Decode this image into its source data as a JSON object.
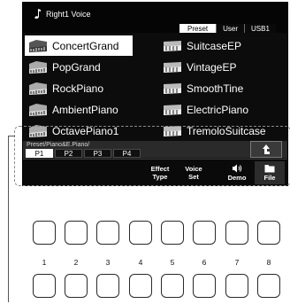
{
  "window": {
    "title": "Right1 Voice",
    "title_icon": "music-note-icon"
  },
  "tabs": [
    {
      "label": "Preset",
      "active": true
    },
    {
      "label": "User",
      "active": false
    },
    {
      "label": "USB1",
      "active": false
    }
  ],
  "voices": [
    {
      "name": "ConcertGrand",
      "icon": "grand-piano-icon",
      "selected": true
    },
    {
      "name": "PopGrand",
      "icon": "grand-piano-icon",
      "selected": false
    },
    {
      "name": "RockPiano",
      "icon": "grand-piano-icon",
      "selected": false
    },
    {
      "name": "AmbientPiano",
      "icon": "grand-piano-icon",
      "selected": false
    },
    {
      "name": "OctavePiano1",
      "icon": "grand-piano-icon",
      "selected": false
    },
    {
      "name": "SuitcaseEP",
      "icon": "electric-piano-icon",
      "selected": false
    },
    {
      "name": "VintageEP",
      "icon": "electric-piano-icon",
      "selected": false
    },
    {
      "name": "SmoothTine",
      "icon": "electric-piano-icon",
      "selected": false
    },
    {
      "name": "ElectricPiano",
      "icon": "electric-piano-icon",
      "selected": false
    },
    {
      "name": "TremoloSuitcase",
      "icon": "electric-piano-icon",
      "selected": false
    }
  ],
  "path": "Preset/Piano&E.Piano/",
  "pages": [
    {
      "label": "P1",
      "active": true
    },
    {
      "label": "P2",
      "active": false
    },
    {
      "label": "P3",
      "active": false
    },
    {
      "label": "P4",
      "active": false
    }
  ],
  "up_button": {
    "icon": "up-arrow-icon"
  },
  "functions": {
    "effect_type": {
      "line1": "Effect",
      "line2": "Type"
    },
    "voice_set": {
      "line1": "Voice",
      "line2": "Set"
    },
    "demo": {
      "label": "Demo",
      "icon": "speaker-icon"
    },
    "file": {
      "label": "File",
      "icon": "folder-icon"
    }
  },
  "hardware_buttons": [
    "1",
    "2",
    "3",
    "4",
    "5",
    "6",
    "7",
    "8"
  ],
  "colors": {
    "screen_bg": "#1a1a1a",
    "selected_bg": "#ffffff",
    "text": "#ffffff"
  }
}
